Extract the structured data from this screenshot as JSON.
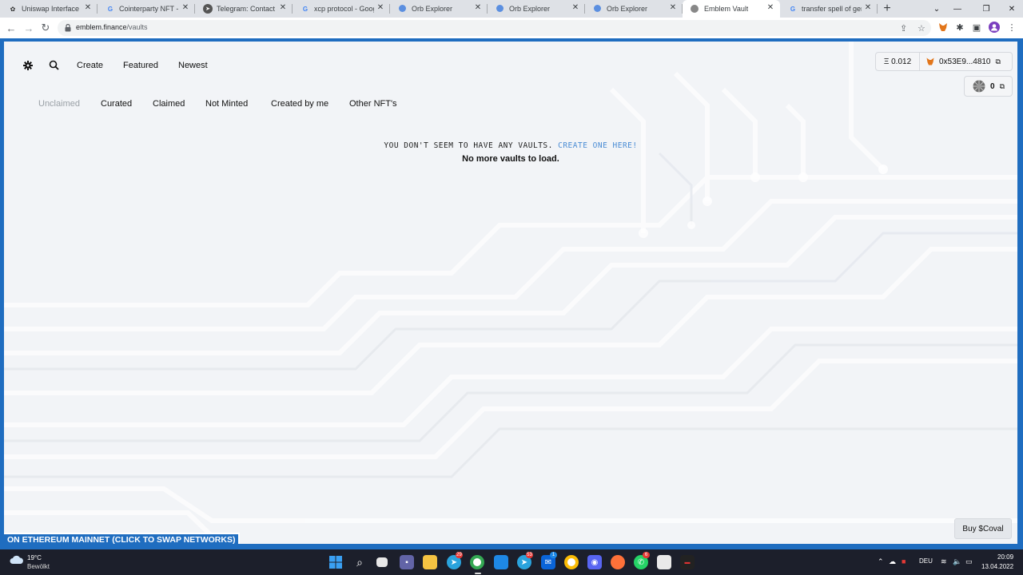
{
  "browser": {
    "tabs": [
      {
        "title": "Uniswap Interface",
        "icon": "uniswap-icon"
      },
      {
        "title": "Cointerparty NFT - Go",
        "icon": "google-icon"
      },
      {
        "title": "Telegram: Contact @C",
        "icon": "telegram-icon"
      },
      {
        "title": "xcp protocol - Google",
        "icon": "google-icon"
      },
      {
        "title": "Orb Explorer",
        "icon": "orb-icon"
      },
      {
        "title": "Orb Explorer",
        "icon": "orb-icon"
      },
      {
        "title": "Orb Explorer",
        "icon": "orb-icon"
      },
      {
        "title": "Emblem Vault",
        "icon": "emblem-icon",
        "active": true
      },
      {
        "title": "transfer spell of gene",
        "icon": "google-icon"
      }
    ],
    "new_tab_label": "+",
    "address": {
      "domain": "emblem.finance",
      "path": "/vaults"
    }
  },
  "app": {
    "top_nav": {
      "create": "Create",
      "featured": "Featured",
      "newest": "Newest"
    },
    "sub_nav": {
      "unclaimed": "Unclaimed",
      "curated": "Curated",
      "claimed": "Claimed",
      "not_minted": "Not Minted",
      "created_by_me": "Created by me",
      "other_nfts": "Other NFT's"
    },
    "wallet": {
      "eth_balance": "Ξ 0.012",
      "address": "0x53E9...4810",
      "coval_count": "0"
    },
    "empty_message": "YOU DON'T SEEM TO HAVE ANY VAULTS.",
    "create_link": "CREATE ONE HERE!",
    "no_more": "No more vaults to load.",
    "network_banner": "ON ETHEREUM MAINNET (CLICK TO SWAP NETWORKS)",
    "buy_button": "Buy $Coval"
  },
  "taskbar": {
    "weather_temp": "19°C",
    "weather_desc": "Bewölkt",
    "badges": {
      "telegram1": "29",
      "telegram2": "53",
      "mail": "1",
      "whatsapp": "6"
    },
    "language": "DEU",
    "time": "20:09",
    "date": "13.04.2022"
  },
  "colors": {
    "accent": "#1f6dc0",
    "link": "#4a8cd4",
    "page_bg": "#f2f4f7"
  }
}
